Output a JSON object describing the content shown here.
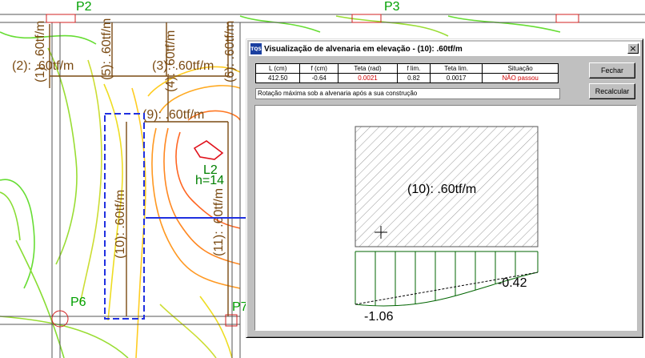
{
  "plan": {
    "pillars": [
      {
        "label": "P2"
      },
      {
        "label": "P3"
      },
      {
        "label": "P6"
      },
      {
        "label": "P7"
      }
    ],
    "walls": [
      {
        "label": "(2): .60tf/m"
      },
      {
        "label": "(1): .60tf/m"
      },
      {
        "label": "(5): .60tf/m"
      },
      {
        "label": "(3): .60tf/m"
      },
      {
        "label": "(4): .60tf/m"
      },
      {
        "label": "(9): .60tf/m"
      },
      {
        "label": "(6): .60tf/m"
      },
      {
        "label": "(10): .60tf/m"
      },
      {
        "label": "(11): .60tf/m"
      }
    ],
    "slab": {
      "name": "L2",
      "thickness": "h=14"
    }
  },
  "dialog": {
    "title": "Visualização de alvenaria em elevação - (10): .60tf/m",
    "icon_text": "TQS",
    "close_glyph": "×",
    "table": {
      "headers": [
        "L (cm)",
        "f (cm)",
        "Teta (rad)",
        "f lim.",
        "Teta lim.",
        "Situação"
      ],
      "values": [
        "412.50",
        "-0.64",
        "0.0021",
        "0.82",
        "0.0017",
        "NÃO passou"
      ]
    },
    "status_text": "Rotação máxima sob a alvenaria após a sua construção",
    "buttons": {
      "close": "Fechar",
      "recalc": "Recalcular"
    },
    "elevation": {
      "wall_label": "(10): .60tf/m",
      "deflection_min": "-1.06",
      "deflection_end": "-0.42"
    }
  },
  "colors": {
    "wall": "#7a4a12",
    "pillar_label": "#00a000",
    "selection": "#2030e0",
    "fail_text": "#d00000",
    "deflection": "#006400"
  }
}
